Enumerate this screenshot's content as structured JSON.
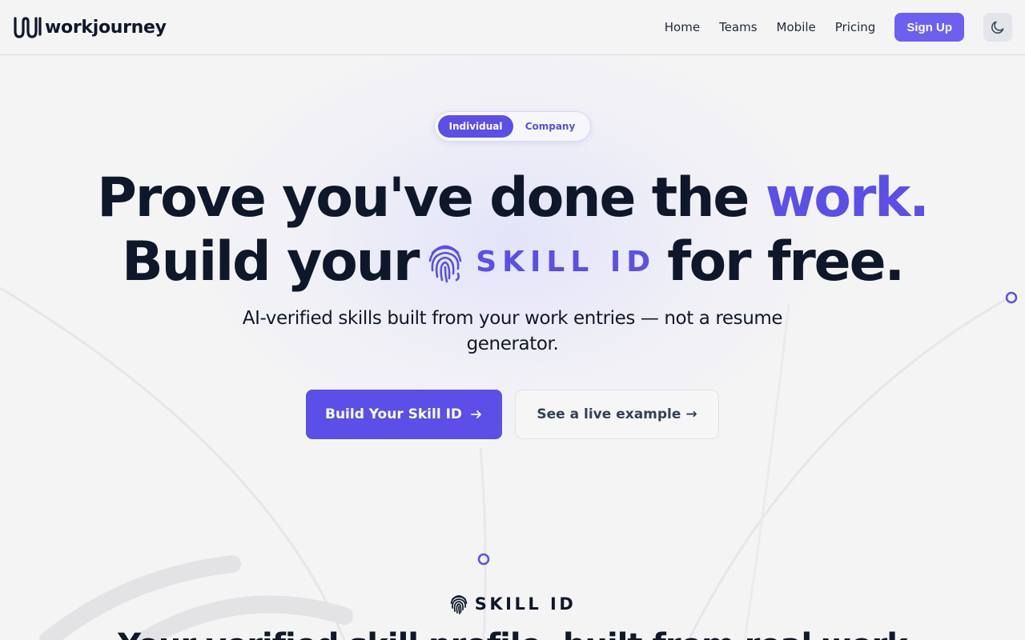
{
  "brand": {
    "name": "workjourney"
  },
  "nav": {
    "links": [
      "Home",
      "Teams",
      "Mobile",
      "Pricing"
    ],
    "signup_label": "Sign Up",
    "theme_icon": "moon-icon"
  },
  "toggle": {
    "active": "Individual",
    "inactive": "Company"
  },
  "hero": {
    "line1_text": "Prove you've done the",
    "line1_accent": "work.",
    "line2_start": "Build your",
    "badge_label": "SKILL ID",
    "badge_icon": "fingerprint-icon",
    "line2_end": "for free.",
    "subtitle": "AI-verified skills built from your work entries — not a resume generator."
  },
  "cta": {
    "primary": "Build Your Skill ID",
    "primary_icon": "arrow-right-icon",
    "secondary": "See a live example →"
  },
  "section": {
    "label": "SKILL ID",
    "label_icon": "fingerprint-icon",
    "title": "Your verified skill profile, built from real work"
  },
  "colors": {
    "accent": "#5b4fe8",
    "signup": "#6d5ff0",
    "text": "#0f172a",
    "background": "#f4f4f5"
  }
}
